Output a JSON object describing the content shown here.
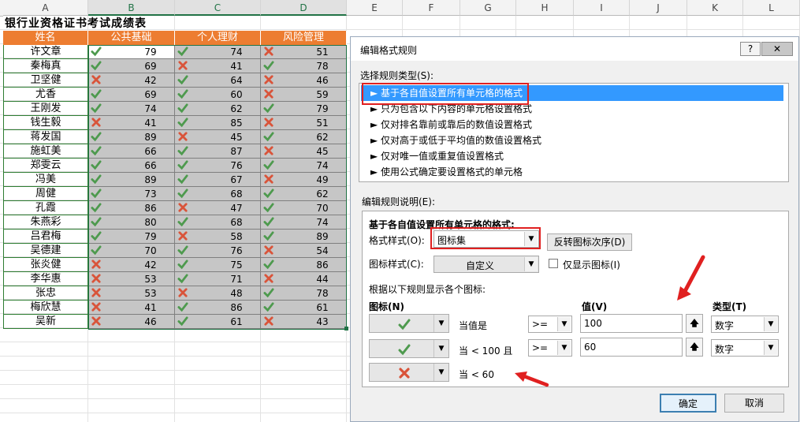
{
  "spreadsheet": {
    "columns": [
      "A",
      "B",
      "C",
      "D",
      "E",
      "F",
      "G",
      "H",
      "I",
      "J",
      "K",
      "L"
    ],
    "title": "银行业资格证书考试成绩表",
    "headers": [
      "姓名",
      "公共基础",
      "个人理财",
      "风险管理"
    ],
    "rows": [
      {
        "name": "许文章",
        "scores": [
          79,
          74,
          51
        ]
      },
      {
        "name": "秦梅真",
        "scores": [
          69,
          41,
          78
        ]
      },
      {
        "name": "卫坚健",
        "scores": [
          42,
          64,
          46
        ]
      },
      {
        "name": "尤香",
        "scores": [
          69,
          60,
          59
        ]
      },
      {
        "name": "王刚发",
        "scores": [
          74,
          62,
          79
        ]
      },
      {
        "name": "钱生毅",
        "scores": [
          41,
          85,
          51
        ]
      },
      {
        "name": "蒋发国",
        "scores": [
          89,
          45,
          62
        ]
      },
      {
        "name": "施虹美",
        "scores": [
          66,
          87,
          45
        ]
      },
      {
        "name": "郑雯云",
        "scores": [
          66,
          76,
          74
        ]
      },
      {
        "name": "冯美",
        "scores": [
          89,
          67,
          49
        ]
      },
      {
        "name": "周健",
        "scores": [
          73,
          68,
          62
        ]
      },
      {
        "name": "孔霞",
        "scores": [
          86,
          47,
          70
        ]
      },
      {
        "name": "朱燕彩",
        "scores": [
          80,
          68,
          74
        ]
      },
      {
        "name": "吕君梅",
        "scores": [
          79,
          58,
          89
        ]
      },
      {
        "name": "吴德建",
        "scores": [
          70,
          76,
          54
        ]
      },
      {
        "name": "张炎健",
        "scores": [
          42,
          75,
          86
        ]
      },
      {
        "name": "李华惠",
        "scores": [
          53,
          71,
          44
        ]
      },
      {
        "name": "张忠",
        "scores": [
          53,
          48,
          78
        ]
      },
      {
        "name": "梅欣慧",
        "scores": [
          41,
          86,
          61
        ]
      },
      {
        "name": "吴新",
        "scores": [
          46,
          61,
          43
        ]
      }
    ],
    "icon_threshold": 60,
    "colors": {
      "header_bg": "#ed7d31",
      "check": "#4e9a4e",
      "cross": "#d9543a",
      "selection": "#217346"
    }
  },
  "dialog": {
    "title": "编辑格式规则",
    "help_label": "?",
    "close_label": "✕",
    "select_rule_type_label": "选择规则类型(S):",
    "rule_types": [
      "► 基于各自值设置所有单元格的格式",
      "► 只为包含以下内容的单元格设置格式",
      "► 仅对排名靠前或靠后的数值设置格式",
      "► 仅对高于或低于平均值的数值设置格式",
      "► 仅对唯一值或重复值设置格式",
      "► 使用公式确定要设置格式的单元格"
    ],
    "edit_desc_label": "编辑规则说明(E):",
    "desc_heading": "基于各自值设置所有单元格的格式:",
    "format_style_label": "格式样式(O):",
    "format_style_value": "图标集",
    "reverse_button": "反转图标次序(D)",
    "icon_style_label": "图标样式(C):",
    "icon_style_value": "自定义",
    "show_icon_only_label": "仅显示图标(I)",
    "rules_caption": "根据以下规则显示各个图标:",
    "col_icon": "图标(N)",
    "col_value": "值(V)",
    "col_type": "类型(T)",
    "icon_rules": [
      {
        "icon": "check-icon",
        "condition": "当值是",
        "operator": ">=",
        "value": "100",
        "type": "数字"
      },
      {
        "icon": "check-icon",
        "condition": "当 < 100 且",
        "operator": ">=",
        "value": "60",
        "type": "数字"
      },
      {
        "icon": "cross-icon",
        "condition": "当 < 60"
      }
    ],
    "ok_button": "确定",
    "cancel_button": "取消"
  }
}
